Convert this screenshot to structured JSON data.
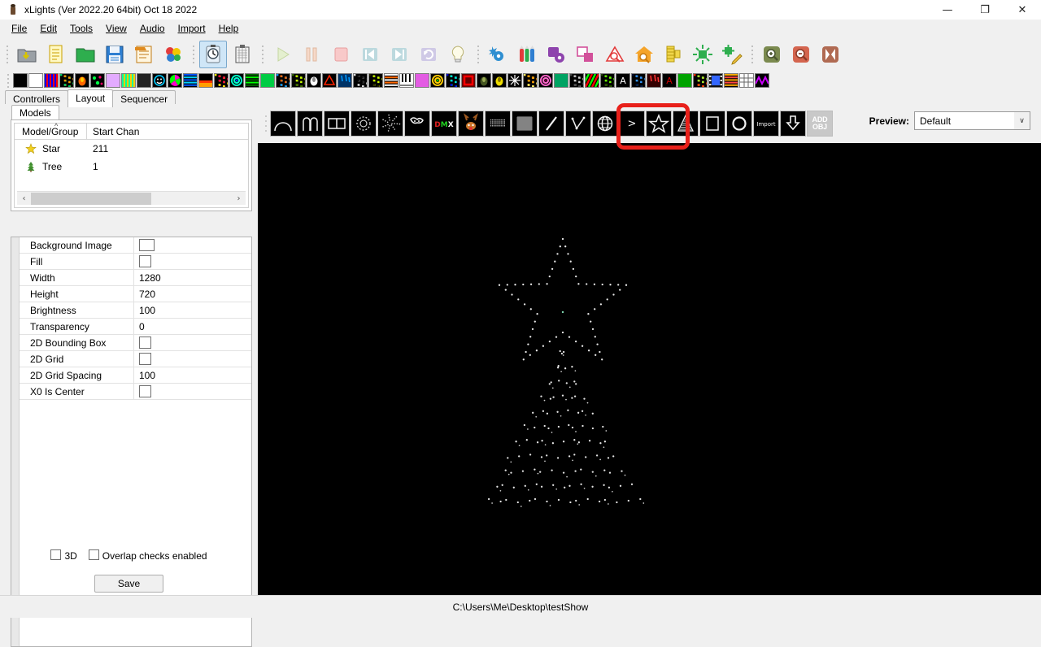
{
  "window": {
    "title": "xLights (Ver 2022.20 64bit) Oct 18 2022",
    "icon": "xlights-app-icon",
    "minimize": "—",
    "maximize": "❐",
    "close": "✕"
  },
  "menu": [
    {
      "label": "File"
    },
    {
      "label": "Edit"
    },
    {
      "label": "Tools"
    },
    {
      "label": "View"
    },
    {
      "label": "Audio"
    },
    {
      "label": "Import"
    },
    {
      "label": "Help"
    }
  ],
  "main_toolbar": {
    "groups": [
      {
        "name": "file-group",
        "buttons": [
          {
            "icon": "new-show-folder-icon"
          },
          {
            "icon": "new-sequence-icon"
          },
          {
            "icon": "open-sequence-icon"
          },
          {
            "icon": "save-icon"
          },
          {
            "icon": "save-as-icon"
          },
          {
            "icon": "render-all-icon"
          }
        ]
      },
      {
        "name": "schedule-group",
        "buttons": [
          {
            "icon": "scheduler-icon",
            "active": true
          },
          {
            "icon": "check-sequence-icon"
          }
        ]
      },
      {
        "name": "playback-group",
        "buttons": [
          {
            "icon": "play-icon"
          },
          {
            "icon": "pause-icon"
          },
          {
            "icon": "stop-icon"
          },
          {
            "icon": "rewind-icon"
          },
          {
            "icon": "fast-forward-icon"
          },
          {
            "icon": "replay-icon"
          },
          {
            "icon": "lights-on-icon"
          }
        ]
      },
      {
        "name": "edit-group",
        "buttons": [
          {
            "icon": "render-effects-icon"
          },
          {
            "icon": "color-manager-icon"
          },
          {
            "icon": "model-preview-icon"
          },
          {
            "icon": "house-preview-icon"
          },
          {
            "icon": "effect-assist-icon"
          },
          {
            "icon": "house-zoom-icon"
          },
          {
            "icon": "papagayo-icon"
          },
          {
            "icon": "effect-settings-icon"
          },
          {
            "icon": "edit-effect-icon"
          }
        ]
      },
      {
        "name": "zoom-group",
        "buttons": [
          {
            "icon": "zoom-in-icon"
          },
          {
            "icon": "zoom-out-icon"
          },
          {
            "icon": "fit-to-window-icon"
          }
        ]
      }
    ]
  },
  "effects_strip": {
    "name": "effects-palette",
    "effects": [
      {
        "name": "off-effect",
        "c1": "#000000",
        "c2": "#000000",
        "style": "solid"
      },
      {
        "name": "on-effect",
        "c1": "#ffffff",
        "c2": "#ffffff",
        "style": "solid"
      },
      {
        "name": "bars-effect",
        "c1": "#ff0000",
        "c2": "#0000ff",
        "style": "vbars"
      },
      {
        "name": "butterfly-effect",
        "c1": "#ff9900",
        "c2": "#00cc66",
        "style": "noise"
      },
      {
        "name": "candle-effect",
        "c1": "#ff6600",
        "c2": "#ffcc00",
        "style": "blob"
      },
      {
        "name": "circles-effect",
        "c1": "#00ff44",
        "c2": "#ff0066",
        "style": "dots"
      },
      {
        "name": "color-wash-effect",
        "c1": "#cc66ff",
        "c2": "#ffffff",
        "style": "grad"
      },
      {
        "name": "curtain-effect",
        "c1": "#ffcc00",
        "c2": "#00ff99",
        "style": "vbars"
      },
      {
        "name": "dmx-effect",
        "c1": "#222222",
        "c2": "#eeeeee",
        "style": "solid"
      },
      {
        "name": "faces-effect",
        "c1": "#00ccff",
        "c2": "#ffffff",
        "style": "face"
      },
      {
        "name": "fan-effect",
        "c1": "#ff00cc",
        "c2": "#00ff00",
        "style": "pinwheel"
      },
      {
        "name": "fill-effect",
        "c1": "#00d0ff",
        "c2": "#0055ff",
        "style": "bars"
      },
      {
        "name": "fire-effect",
        "c1": "#ff3300",
        "c2": "#ffcc00",
        "style": "fire"
      },
      {
        "name": "fireworks-effect",
        "c1": "#ff0044",
        "c2": "#ffee00",
        "style": "noise"
      },
      {
        "name": "galaxy-effect",
        "c1": "#00ffcc",
        "c2": "#0044ff",
        "style": "spiral"
      },
      {
        "name": "garlands-effect",
        "c1": "#00ff00",
        "c2": "#006600",
        "style": "bars"
      },
      {
        "name": "glediator-effect",
        "c1": "#00cc44",
        "c2": "#99ff99",
        "style": "solid"
      },
      {
        "name": "kaleidoscope-effect",
        "c1": "#ff6600",
        "c2": "#0099ff",
        "style": "noise"
      },
      {
        "name": "lightning-effect",
        "c1": "#ccff00",
        "c2": "#336600",
        "style": "noise"
      },
      {
        "name": "liquid-effect",
        "c1": "#ffffff",
        "c2": "#888888",
        "style": "blob"
      },
      {
        "name": "marquee-effect",
        "c1": "#ff2200",
        "c2": "#550000",
        "style": "tri"
      },
      {
        "name": "meteors-effect",
        "c1": "#0099ff",
        "c2": "#003366",
        "style": "drop"
      },
      {
        "name": "morph-effect",
        "c1": "#111111",
        "c2": "#dddddd",
        "style": "noise"
      },
      {
        "name": "music-effect",
        "c1": "#ccff00",
        "c2": "#222200",
        "style": "noise"
      },
      {
        "name": "pictures-effect",
        "c1": "#ff6600",
        "c2": "#ffffff",
        "style": "bars"
      },
      {
        "name": "piano-effect",
        "c1": "#ffffff",
        "c2": "#000000",
        "style": "piano"
      },
      {
        "name": "pinwheel-effect",
        "c1": "#cc00cc",
        "c2": "#ffccff",
        "style": "grad"
      },
      {
        "name": "plasma-effect",
        "c1": "#ffcc00",
        "c2": "#00cc00",
        "style": "spiral"
      },
      {
        "name": "ripple-effect",
        "c1": "#00ffcc",
        "c2": "#0000cc",
        "style": "noise"
      },
      {
        "name": "shimmer-effect",
        "c1": "#ff0000",
        "c2": "#660000",
        "style": "box"
      },
      {
        "name": "shockwave-effect",
        "c1": "#445522",
        "c2": "#99aa55",
        "style": "blob"
      },
      {
        "name": "single-strand-effect",
        "c1": "#eedd00",
        "c2": "#887700",
        "style": "blob"
      },
      {
        "name": "snowflakes-effect",
        "c1": "#ffffff",
        "c2": "#ddeeff",
        "style": "flake"
      },
      {
        "name": "snowstorm-effect",
        "c1": "#ff9900",
        "c2": "#ffee66",
        "style": "noise"
      },
      {
        "name": "spirals-effect",
        "c1": "#ff66cc",
        "c2": "#660033",
        "style": "spiral"
      },
      {
        "name": "spirograph-effect",
        "c1": "#00ff99",
        "c2": "#003322",
        "style": "grad"
      },
      {
        "name": "state-effect",
        "c1": "#cccccc",
        "c2": "#444444",
        "style": "noise"
      },
      {
        "name": "strobe-effect",
        "c1": "#ff0000",
        "c2": "#00ff00",
        "style": "diag"
      },
      {
        "name": "tendril-effect",
        "c1": "#66ff00",
        "c2": "#224400",
        "style": "noise"
      },
      {
        "name": "text-effect",
        "c1": "#ffffff",
        "c2": "#000000",
        "style": "text"
      },
      {
        "name": "tree-effect",
        "c1": "#3399ff",
        "c2": "#001133",
        "style": "noise"
      },
      {
        "name": "twinkle-effect",
        "c1": "#ff3333",
        "c2": "#330000",
        "style": "drop"
      },
      {
        "name": "vumeter-effect",
        "c1": "#cc0000",
        "c2": "#00aa00",
        "style": "text"
      },
      {
        "name": "warp-effect",
        "c1": "#00ff00",
        "c2": "#003300",
        "style": "grad"
      },
      {
        "name": "wave-effect",
        "c1": "#99ff33",
        "c2": "#ff3300",
        "style": "noise"
      },
      {
        "name": "video-effect",
        "c1": "#3366ff",
        "c2": "#111111",
        "style": "film"
      },
      {
        "name": "vumeter2-effect",
        "c1": "#ff4444",
        "c2": "#ffaa00",
        "style": "bars"
      },
      {
        "name": "servo-effect",
        "c1": "#ffffff",
        "c2": "#cccccc",
        "style": "grid"
      },
      {
        "name": "wreath-effect",
        "c1": "#cc00ff",
        "c2": "#ffffff",
        "style": "zig"
      }
    ]
  },
  "tabs": [
    {
      "label": "Controllers",
      "selected": false
    },
    {
      "label": "Layout",
      "selected": true
    },
    {
      "label": "Sequencer",
      "selected": false
    }
  ],
  "left_panel": {
    "models_tab": "Models",
    "columns": {
      "model_group": "Model/Group",
      "start_chan": "Start Chan"
    },
    "rows": [
      {
        "icon": "star-model-icon",
        "name": "Star",
        "start_chan": "211"
      },
      {
        "icon": "tree-model-icon",
        "name": "Tree",
        "start_chan": "1"
      }
    ],
    "scroll": {
      "left_arrow": "‹",
      "right_arrow": "›"
    },
    "properties": [
      {
        "label": "Background Image",
        "type": "filebox",
        "value": ""
      },
      {
        "label": "Fill",
        "type": "checkbox",
        "value": ""
      },
      {
        "label": "Width",
        "type": "text",
        "value": "1280"
      },
      {
        "label": "Height",
        "type": "text",
        "value": "720"
      },
      {
        "label": "Brightness",
        "type": "text",
        "value": "100"
      },
      {
        "label": "Transparency",
        "type": "text",
        "value": "0"
      },
      {
        "label": "2D Bounding Box",
        "type": "checkbox",
        "value": ""
      },
      {
        "label": "2D Grid",
        "type": "checkbox",
        "value": ""
      },
      {
        "label": "2D Grid Spacing",
        "type": "text",
        "value": "100"
      },
      {
        "label": "X0 Is Center",
        "type": "checkbox",
        "value": ""
      }
    ],
    "checkboxes": [
      {
        "label": "3D",
        "checked": false
      },
      {
        "label": "Overlap checks enabled",
        "checked": false
      }
    ],
    "save_button": "Save"
  },
  "model_toolbar": {
    "buttons": [
      {
        "icon": "arch-model-icon"
      },
      {
        "icon": "candy-cane-model-icon"
      },
      {
        "icon": "cube-model-icon"
      },
      {
        "icon": "circle-model-icon"
      },
      {
        "icon": "sphere-model-icon"
      },
      {
        "icon": "icicle-model-icon"
      },
      {
        "icon": "dmx-model-icon",
        "text": "DMX"
      },
      {
        "icon": "image-model-icon"
      },
      {
        "icon": "matrix-model-icon"
      },
      {
        "icon": "grid-model-icon"
      },
      {
        "icon": "single-line-model-icon"
      },
      {
        "icon": "poly-line-model-icon"
      },
      {
        "icon": "sphere-globe-model-icon"
      },
      {
        "icon": "spinner-model-icon"
      },
      {
        "icon": "star-model-icon",
        "highlighted": true
      },
      {
        "icon": "tree-model-icon",
        "highlighted": true
      },
      {
        "icon": "window-frame-model-icon"
      },
      {
        "icon": "wreath-model-icon"
      },
      {
        "icon": "import-model-icon",
        "text": "Import"
      },
      {
        "icon": "download-model-icon"
      },
      {
        "icon": "add-object-icon",
        "text": "ADD OBJ"
      }
    ],
    "highlight_annotation": {
      "color": "#e8201a",
      "shape": "rounded-rect"
    }
  },
  "preview": {
    "label": "Preview:",
    "value": "Default",
    "arrow": "∨"
  },
  "canvas": {
    "background": "#000000",
    "models": [
      {
        "name": "star-model-render",
        "shape": "star",
        "dot_color": "#e8e8e8"
      },
      {
        "name": "tree-model-render",
        "shape": "cone-tree",
        "dot_color": "#e0e0e0"
      }
    ]
  },
  "status_bar": {
    "path": "C:\\Users\\Me\\Desktop\\testShow"
  }
}
